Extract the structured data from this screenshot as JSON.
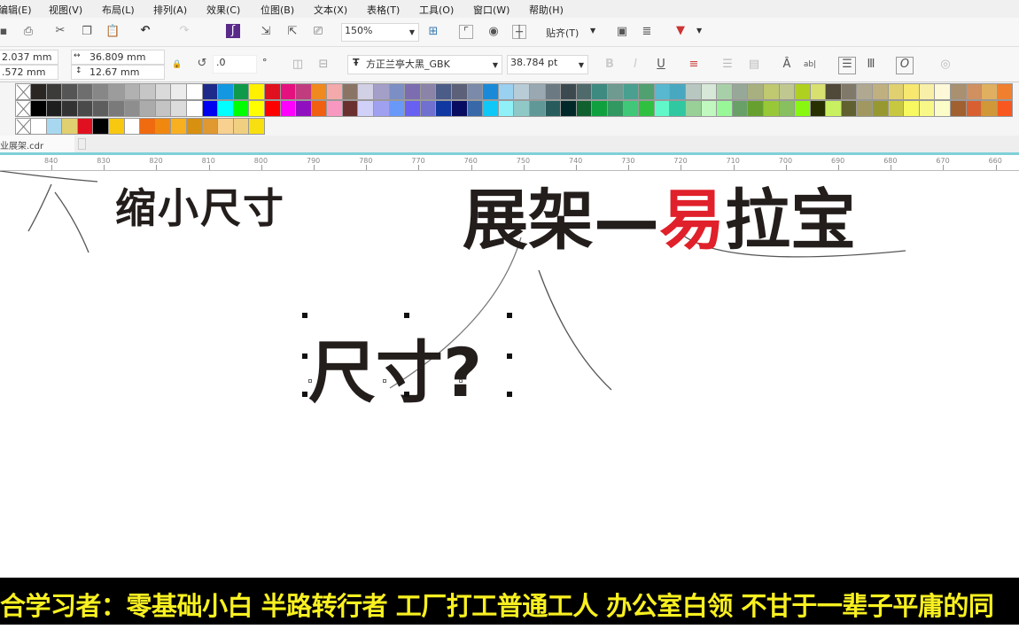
{
  "menu": [
    "编辑(E)",
    "视图(V)",
    "布局(L)",
    "排列(A)",
    "效果(C)",
    "位图(B)",
    "文本(X)",
    "表格(T)",
    "工具(O)",
    "窗口(W)",
    "帮助(H)"
  ],
  "toolbar": {
    "zoom": "150%",
    "snap": "贴齐(T)"
  },
  "propbar": {
    "x": "2.037 mm",
    "y": ".572 mm",
    "width": "36.809 mm",
    "height": "12.67 mm",
    "rotation": ".0",
    "degree": "°",
    "font": "方正兰亭大黑_GBK",
    "font_size": "38.784 pt"
  },
  "palette": {
    "row1": [
      "#2a2624",
      "#3d3b3a",
      "#555555",
      "#6e6e6e",
      "#878787",
      "#9c9c9c",
      "#b1b1b1",
      "#c6c6c6",
      "#dadada",
      "#ececec",
      "#ffffff",
      "#1d2a8a",
      "#1297e0",
      "#0f9a4a",
      "#fff100",
      "#e0101e",
      "#e5117f",
      "#c03c7e",
      "#f08a1e",
      "#f4a9aa",
      "#8a7565",
      "#d2d0e4",
      "#a49fc8",
      "#7c8fc4",
      "#7c6db0",
      "#8c83a8",
      "#4c5c88",
      "#5c6078",
      "#7a8aa8",
      "#1a8ad8",
      "#9ad0f0",
      "#b8ccd8",
      "#9aa8b2",
      "#6b7a82",
      "#3c4a50",
      "#4e6a6a",
      "#3c8a80",
      "#6e9a90",
      "#4aa090",
      "#50a070",
      "#58b8d0",
      "#48a8c0",
      "#b8c8c0",
      "#d8e8d8",
      "#a8d0a8",
      "#98a898",
      "#a8b080",
      "#c0c870",
      "#c0c890",
      "#b0d020",
      "#d8e070",
      "#504838",
      "#807868",
      "#b0a890",
      "#c0b080",
      "#e0d070",
      "#f8e870",
      "#f8f0a8",
      "#fcf8d8",
      "#a89070",
      "#d09060",
      "#e0b060",
      "#f08030"
    ],
    "row2": [
      "#000000",
      "#1e1e1e",
      "#333333",
      "#4a4a4a",
      "#5e5e5e",
      "#7a7a7a",
      "#8e8e8e",
      "#ababab",
      "#c4c4c4",
      "#dcdcdc",
      "#ffffff",
      "#0000f0",
      "#00ffff",
      "#00ff00",
      "#ffff00",
      "#ff0000",
      "#ff00ff",
      "#9010c0",
      "#f06010",
      "#f898c0",
      "#6a3030",
      "#d0d0f8",
      "#a0a0f0",
      "#6898f8",
      "#6860f0",
      "#7070d0",
      "#1038a0",
      "#080c60",
      "#3868a8",
      "#10c8f8",
      "#90f0f8",
      "#90c8c8",
      "#609898",
      "#285c5c",
      "#002828",
      "#106030",
      "#10a040",
      "#309860",
      "#40c878",
      "#30c040",
      "#60f8c8",
      "#30c8a0",
      "#98d098",
      "#c0f8c0",
      "#98f898",
      "#68a068",
      "#68a030",
      "#98c838",
      "#88c060",
      "#88f810",
      "#283000",
      "#c8f060",
      "#606030",
      "#a09860",
      "#989830",
      "#c8c840",
      "#f8f860",
      "#f8f888",
      "#fcfcc8",
      "#a06030",
      "#d86030",
      "#d09838",
      "#f85820"
    ],
    "row3": [
      "#ffffff",
      "#a8d8f0",
      "#e0d070",
      "#e01020",
      "#000000",
      "#f8c810",
      "#ffffff",
      "#f06a10",
      "#f08810",
      "#f8b020",
      "#d89010",
      "#e09830",
      "#f8d090",
      "#f0d080",
      "#f8e010"
    ]
  },
  "doc_tab": "业展架.cdr",
  "ruler": [
    "840",
    "830",
    "820",
    "810",
    "800",
    "790",
    "780",
    "770",
    "760",
    "750",
    "740",
    "730",
    "720",
    "710",
    "700",
    "690",
    "680",
    "670",
    "660"
  ],
  "canvas": {
    "text1": "缩小尺寸",
    "title_a": "展架—",
    "title_b": "易",
    "title_c": "拉宝",
    "text2": "尺寸?",
    "accent": "#e0202a"
  },
  "subtitle": "合学习者：零基础小白 半路转行者 工厂打工普通工人 办公室白领 不甘于一辈子平庸的同"
}
